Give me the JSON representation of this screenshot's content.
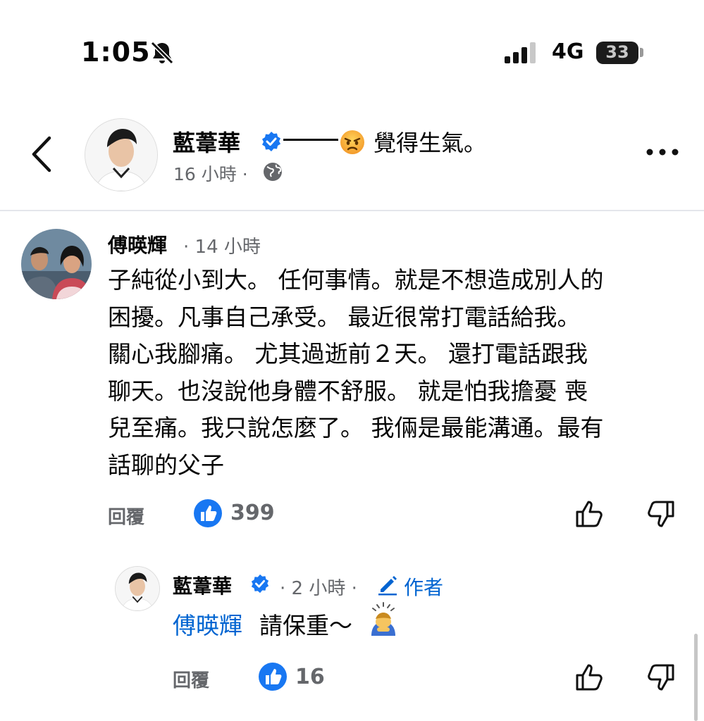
{
  "status_bar": {
    "time": "1:05",
    "network": "4G",
    "battery": "33"
  },
  "post_header": {
    "author": "藍葦華",
    "feeling": "覺得生氣。",
    "time": "16 小時 ·"
  },
  "comments": [
    {
      "author": "傅暎輝",
      "time": "· 14 小時",
      "lines": [
        "子純從小到大。  任何事情。就是不想造成別人的",
        "困擾。凡事自己承受。  最近很常打電話給我。",
        "關心我腳痛。  尤其過逝前２天。  還打電話跟我",
        "聊天。也沒說他身體不舒服。  就是怕我擔憂  喪",
        "兒至痛。我只說怎麼了。  我倆是最能溝通。最有",
        "話聊的父子"
      ],
      "reply_label": "回覆",
      "likes": "399"
    }
  ],
  "reply": {
    "author": "藍葦華",
    "time": "· 2 小時 ·",
    "author_badge": "作者",
    "mention": "傅暎輝",
    "text": "請保重～",
    "reply_label": "回覆",
    "likes": "16"
  },
  "colors": {
    "accent": "#0064d1",
    "like_blue": "#1877f2",
    "muted": "#65676b",
    "verified": "#1877f2"
  },
  "icons": [
    "back-chevron-icon",
    "bell-slash-icon",
    "signal-icon",
    "battery-icon",
    "verified-badge-icon",
    "angry-face-emoji",
    "globe-icon",
    "more-icon",
    "like-reaction-icon",
    "thumbs-up-icon",
    "thumbs-down-icon",
    "pencil-icon",
    "bowing-person-emoji"
  ]
}
